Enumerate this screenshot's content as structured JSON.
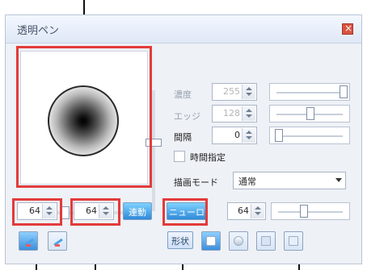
{
  "window": {
    "title": "透明ペン"
  },
  "options": {
    "opacity_label": "濃度",
    "opacity_value": "255",
    "edge_label": "エッジ",
    "edge_value": "128",
    "interval_label": "間隔",
    "interval_value": "0",
    "time_label": "時間指定",
    "mode_label": "描画モード",
    "mode_value": "通常"
  },
  "bottom_controls": {
    "width_value": "64",
    "height_value": "64",
    "link_label": "連動",
    "mode_button_label": "ニューロ",
    "size_value": "64",
    "shape_label": "形状"
  },
  "colors": {
    "window_bg": "#eef1f6",
    "accent": "#3c8fdc",
    "highlight": "#e33b3b"
  }
}
